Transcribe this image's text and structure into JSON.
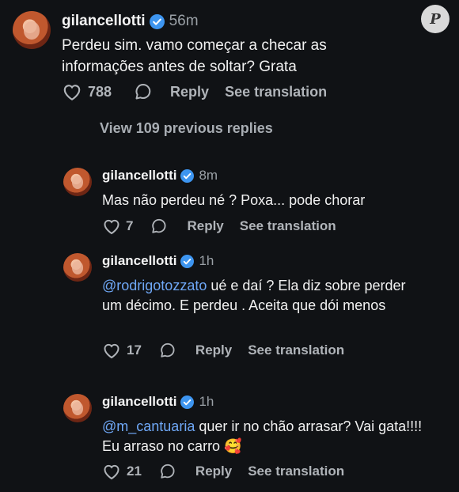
{
  "watermark": "P",
  "top_comment": {
    "username": "gilancellotti",
    "time": "56m",
    "text": "Perdeu sim. vamo começar a checar as informações antes de soltar? Grata",
    "likes": "788",
    "reply_label": "Reply",
    "translation_label": "See translation"
  },
  "view_previous": "View 109 previous replies",
  "replies": [
    {
      "username": "gilancellotti",
      "time": "8m",
      "mention": "",
      "text": "Mas não perdeu né ? Poxa... pode chorar",
      "likes": "7",
      "reply_label": "Reply",
      "translation_label": "See translation"
    },
    {
      "username": "gilancellotti",
      "time": "1h",
      "mention": "@rodrigotozzato",
      "text": " ué e daí ? Ela diz sobre perder um décimo. E perdeu . Aceita que dói menos",
      "likes": "17",
      "reply_label": "Reply",
      "translation_label": "See translation"
    },
    {
      "username": "gilancellotti",
      "time": "1h",
      "mention": "@m_cantuaria",
      "text": " quer ir no chão arrasar? Vai gata!!!! Eu arraso no carro ",
      "emoji": "🥰",
      "likes": "21",
      "reply_label": "Reply",
      "translation_label": "See translation"
    }
  ],
  "colors": {
    "background": "#101215",
    "verified": "#3d95f0",
    "mention": "#6fa8f7",
    "muted": "#9aa0a6"
  }
}
